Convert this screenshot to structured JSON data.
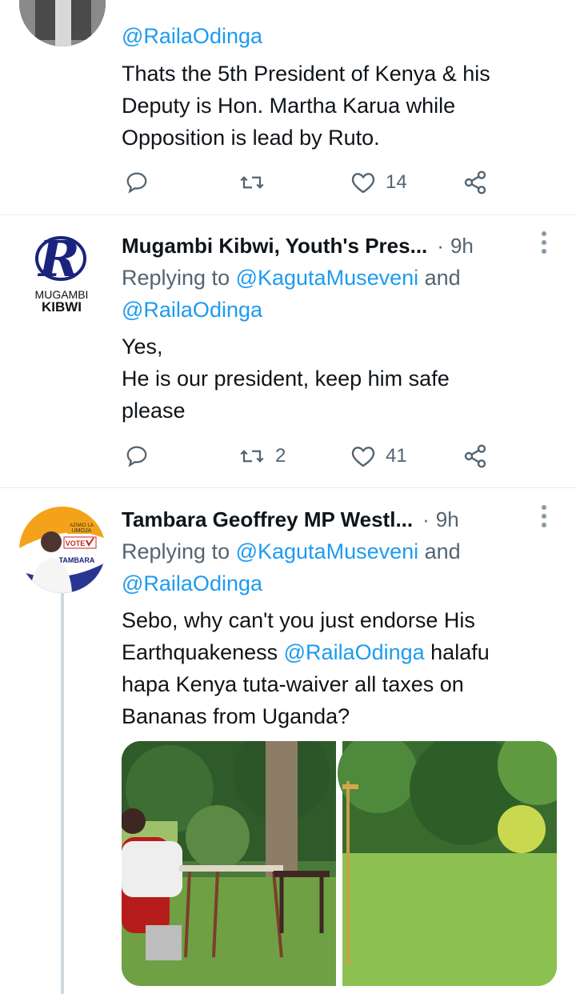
{
  "tweet1": {
    "replying_handle": "@RailaOdinga",
    "body_lines": [
      "Thats the 5th President of Kenya & his",
      "Deputy is Hon. Martha Karua while",
      "Opposition is lead by Ruto."
    ],
    "replies": "",
    "retweets": "",
    "likes": "14"
  },
  "tweet2": {
    "author": "Mugambi Kibwi, Youth's Pres...",
    "time": "9h",
    "avatar_logo_letter": "R",
    "avatar_text_1": "MUGAMBI",
    "avatar_text_2": "KIBWI",
    "replying_prefix": "Replying to ",
    "replying_handle_1": "@KagutaMuseveni",
    "replying_and": " and",
    "replying_handle_2": "@RailaOdinga",
    "body_lines": [
      "Yes,",
      "He is our president, keep him safe",
      "please"
    ],
    "retweets": "2",
    "likes": "41"
  },
  "tweet3": {
    "author": "Tambara Geoffrey MP Westl...",
    "time": "9h",
    "avatar_badge_1": "AZIMIO LA",
    "avatar_badge_2": "UMOJA",
    "avatar_vote": "VOTE",
    "avatar_name": "TAMBARA",
    "replying_prefix": "Replying to ",
    "replying_handle_1": "@KagutaMuseveni",
    "replying_and": " and",
    "replying_handle_2": "@RailaOdinga",
    "body_line1": "Sebo, why can't you just endorse His",
    "body_line2_a": "Earthquakeness ",
    "body_line2_mention": "@RailaOdinga",
    "body_line2_b": " halafu",
    "body_line3": "hapa Kenya tuta-waiver all taxes on",
    "body_line4": "Bananas from Uganda?"
  },
  "dot_separator": "·",
  "icons": [
    "reply-icon",
    "retweet-icon",
    "like-icon",
    "share-icon",
    "more-icon"
  ],
  "colors": {
    "link": "#1d9bf0",
    "secondary": "#536471",
    "divider": "#e6ecf0"
  }
}
